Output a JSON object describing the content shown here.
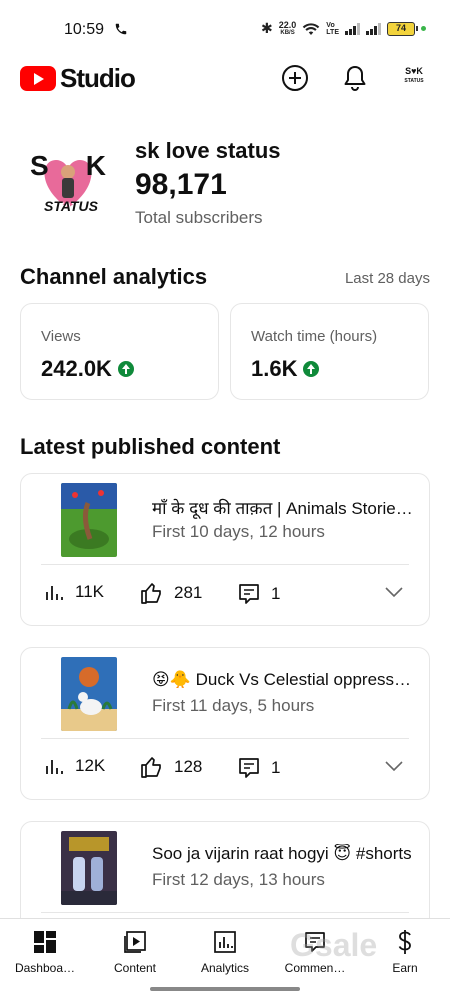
{
  "status_bar": {
    "time": "10:59",
    "speed_value": "22.0",
    "speed_unit": "KB/S",
    "volte_top": "Vo",
    "volte_bottom": "LTE",
    "battery": "74"
  },
  "header": {
    "app_name": "Studio",
    "avatar_text_top": "S♥K",
    "avatar_text_bottom": "STATUS"
  },
  "channel": {
    "name": "sk love status",
    "subscriber_count": "98,171",
    "subscriber_label": "Total subscribers",
    "avatar_text_left": "S",
    "avatar_text_right": "K",
    "avatar_text_bottom": "STATUS"
  },
  "analytics": {
    "title": "Channel analytics",
    "period": "Last 28 days",
    "views_label": "Views",
    "views_value": "242.0K",
    "watch_label": "Watch time (hours)",
    "watch_value": "1.6K"
  },
  "latest": {
    "title": "Latest published content",
    "items": [
      {
        "title": "माँ के दूध की ताक़त | Animals Stories #shorts",
        "age": "First 10 days, 12 hours",
        "views": "11K",
        "likes": "281",
        "comments": "1"
      },
      {
        "title": "😝🐥 Duck Vs Celestial oppression #shorts",
        "age": "First 11 days, 5 hours",
        "views": "12K",
        "likes": "128",
        "comments": "1"
      },
      {
        "title": "Soo ja vijarin raat hogyi 😇 #shorts",
        "age": "First 12 days, 13 hours",
        "views": "",
        "likes": "",
        "comments": ""
      }
    ]
  },
  "nav": {
    "items": [
      {
        "label": "Dashboa…",
        "icon": "dashboard-icon"
      },
      {
        "label": "Content",
        "icon": "content-icon"
      },
      {
        "label": "Analytics",
        "icon": "analytics-icon"
      },
      {
        "label": "Commen…",
        "icon": "comments-icon"
      },
      {
        "label": "Earn",
        "icon": "earn-icon"
      }
    ],
    "watermark": "Gsale"
  }
}
